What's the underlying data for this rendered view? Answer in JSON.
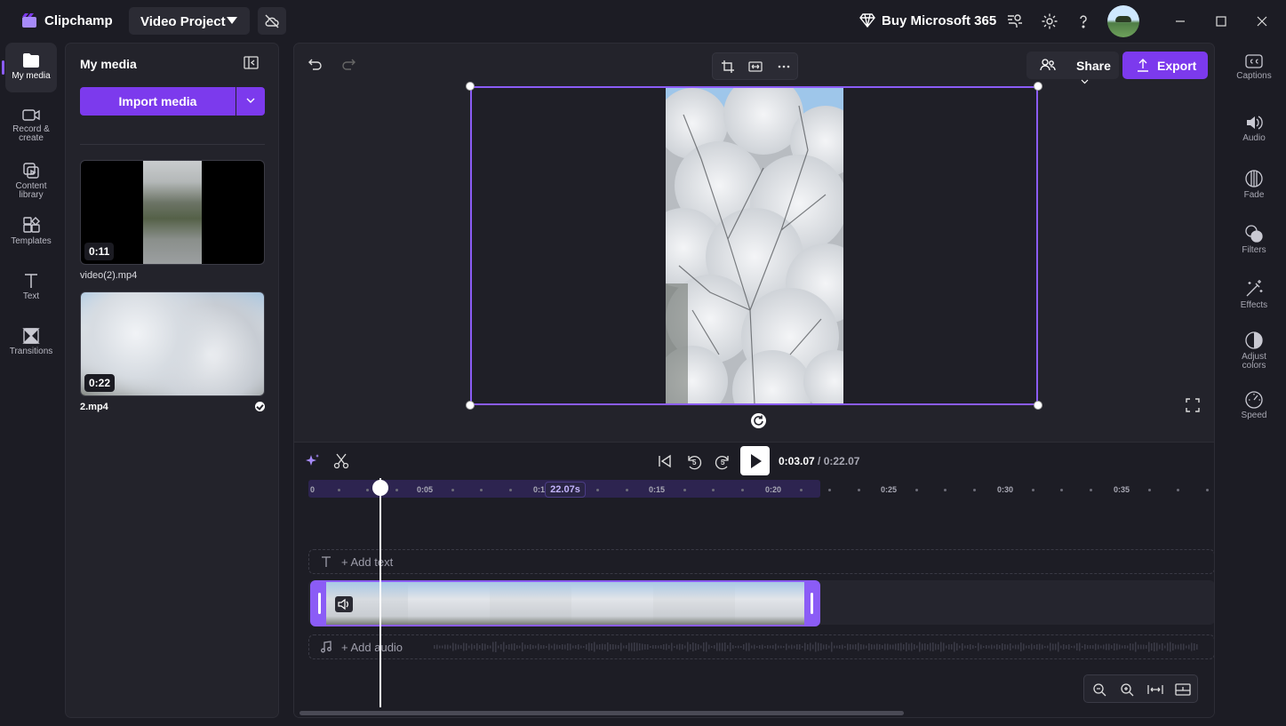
{
  "titlebar": {
    "app_name": "Clipchamp",
    "project_name": "Video Project",
    "buy_label": "Buy Microsoft 365"
  },
  "left_nav": {
    "items": [
      {
        "label": "My media",
        "icon": "folder-icon",
        "active": true
      },
      {
        "label": "Record &\ncreate",
        "icon": "camera-icon"
      },
      {
        "label": "Content\nlibrary",
        "icon": "content-library-icon"
      },
      {
        "label": "Templates",
        "icon": "templates-icon"
      },
      {
        "label": "Text",
        "icon": "text-icon"
      },
      {
        "label": "Transitions",
        "icon": "transitions-icon"
      }
    ]
  },
  "media_panel": {
    "title": "My media",
    "import_label": "Import media",
    "items": [
      {
        "name": "video(2).mp4",
        "duration": "0:11",
        "in_timeline": false
      },
      {
        "name": "2.mp4",
        "duration": "0:22",
        "in_timeline": true
      }
    ]
  },
  "editor": {
    "share_label": "Share",
    "export_label": "Export"
  },
  "playback": {
    "current_time": "0:03.07",
    "total_time": "/ 0:22.07",
    "skip_back_seconds": "5",
    "skip_forward_seconds": "5"
  },
  "timeline": {
    "tick_labels": [
      "0",
      "0:05",
      "0:1",
      "0:15",
      "0:20",
      "0:25",
      "0:30",
      "0:35"
    ],
    "clip_duration": "22.07s",
    "add_text_label": "+ Add text",
    "add_audio_label": "+ Add audio"
  },
  "right_nav": {
    "items": [
      {
        "label": "Captions",
        "icon": "captions-icon"
      },
      {
        "label": "Audio",
        "icon": "speaker-icon"
      },
      {
        "label": "Fade",
        "icon": "fade-icon"
      },
      {
        "label": "Filters",
        "icon": "filters-icon"
      },
      {
        "label": "Effects",
        "icon": "magic-wand-icon"
      },
      {
        "label": "Adjust\ncolors",
        "icon": "adjust-colors-icon"
      },
      {
        "label": "Speed",
        "icon": "speedometer-icon"
      }
    ]
  },
  "colors": {
    "accent": "#7c3aed",
    "accent_light": "#8b5cf6",
    "background": "#1c1c24",
    "panel": "#23232b"
  }
}
